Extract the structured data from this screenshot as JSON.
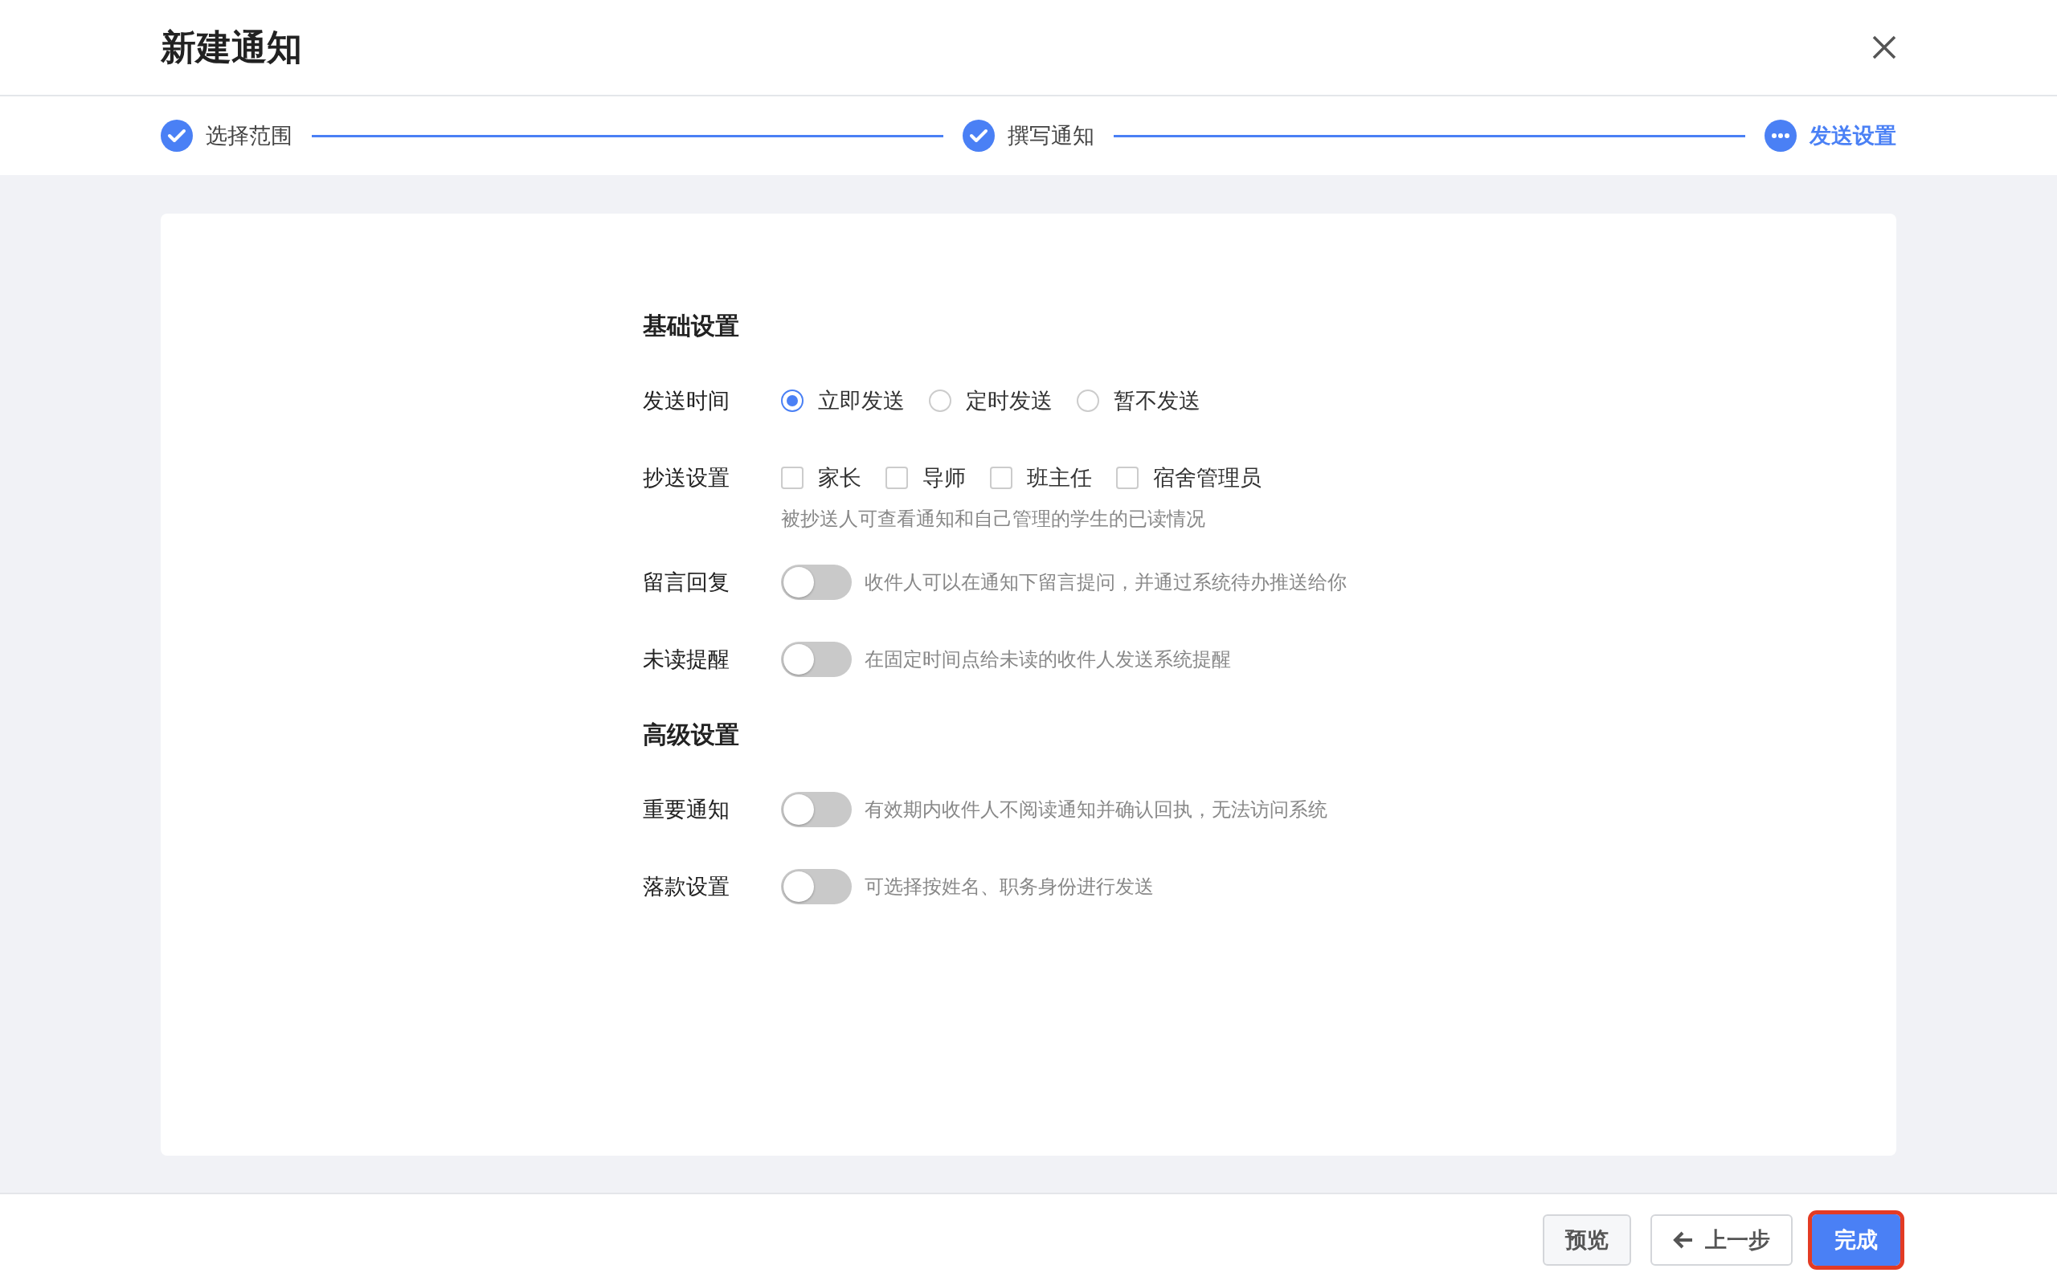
{
  "dialog": {
    "title": "新建通知"
  },
  "steps": [
    {
      "label": "选择范围",
      "done": true,
      "selected": false
    },
    {
      "label": "撰写通知",
      "done": true,
      "selected": false
    },
    {
      "label": "发送设置",
      "done": false,
      "selected": true
    }
  ],
  "sections": [
    {
      "title": "基础设置",
      "rows": [
        {
          "kind": "radio",
          "label": "发送时间",
          "options": [
            {
              "label": "立即发送",
              "selected": true
            },
            {
              "label": "定时发送",
              "selected": false
            },
            {
              "label": "暂不发送",
              "selected": false
            }
          ]
        },
        {
          "kind": "checkbox",
          "label": "抄送设置",
          "options": [
            {
              "label": "家长",
              "checked": false
            },
            {
              "label": "导师",
              "checked": false
            },
            {
              "label": "班主任",
              "checked": false
            },
            {
              "label": "宿舍管理员",
              "checked": false
            }
          ],
          "help": "被抄送人可查看通知和自己管理的学生的已读情况"
        },
        {
          "kind": "switch",
          "label": "留言回复",
          "on": false,
          "help": "收件人可以在通知下留言提问，并通过系统待办推送给你"
        },
        {
          "kind": "switch",
          "label": "未读提醒",
          "on": false,
          "help": "在固定时间点给未读的收件人发送系统提醒"
        }
      ]
    },
    {
      "title": "高级设置",
      "rows": [
        {
          "kind": "switch",
          "label": "重要通知",
          "on": false,
          "help": "有效期内收件人不阅读通知并确认回执，无法访问系统"
        },
        {
          "kind": "switch",
          "label": "落款设置",
          "on": false,
          "help": "可选择按姓名、职务身份进行发送"
        }
      ]
    }
  ],
  "footer": {
    "buttons": [
      {
        "label": "预览",
        "kind": "plain",
        "highlighted": false
      },
      {
        "label": "上一步",
        "kind": "back",
        "highlighted": false
      },
      {
        "label": "完成",
        "kind": "primary",
        "highlighted": true
      }
    ]
  }
}
